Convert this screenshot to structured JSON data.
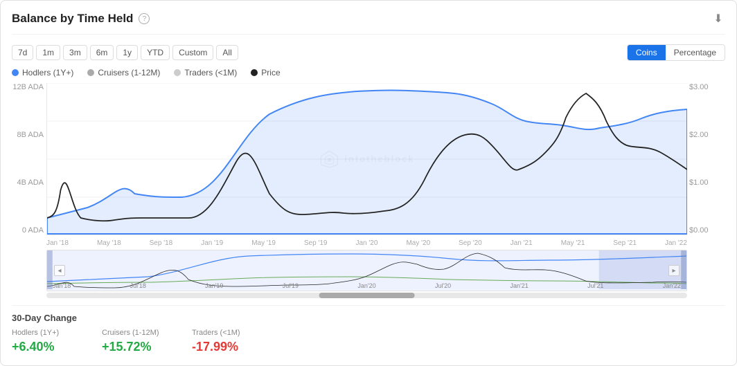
{
  "card": {
    "title": "Balance by Time Held",
    "help_label": "?",
    "download_icon": "⬇"
  },
  "time_filters": [
    {
      "label": "7d",
      "id": "7d"
    },
    {
      "label": "1m",
      "id": "1m"
    },
    {
      "label": "3m",
      "id": "3m"
    },
    {
      "label": "6m",
      "id": "6m"
    },
    {
      "label": "1y",
      "id": "1y"
    },
    {
      "label": "YTD",
      "id": "ytd"
    },
    {
      "label": "Custom",
      "id": "custom"
    },
    {
      "label": "All",
      "id": "all"
    }
  ],
  "view_toggle": {
    "coins_label": "Coins",
    "percentage_label": "Percentage",
    "active": "coins"
  },
  "legend": [
    {
      "label": "Hodlers (1Y+)",
      "color": "#4285f4",
      "type": "filled"
    },
    {
      "label": "Cruisers (1-12M)",
      "color": "#aaaaaa",
      "type": "filled"
    },
    {
      "label": "Traders (<1M)",
      "color": "#cccccc",
      "type": "filled"
    },
    {
      "label": "Price",
      "color": "#222222",
      "type": "filled"
    }
  ],
  "y_axis_left": [
    "12B ADA",
    "8B ADA",
    "4B ADA",
    "0 ADA"
  ],
  "y_axis_right": [
    "$3.00",
    "$2.00",
    "$1.00",
    "$0.00"
  ],
  "x_axis": [
    "Jan '18",
    "May '18",
    "Sep '18",
    "Jan '19",
    "May '19",
    "Sep '19",
    "Jan '20",
    "May '20",
    "Sep '20",
    "Jan '21",
    "May '21",
    "Sep '21",
    "Jan '22"
  ],
  "mini_x_axis": [
    "Jan'18",
    "Jul'18",
    "Jan'19",
    "Jul'19",
    "Jan'20",
    "Jul'20",
    "Jan'21",
    "Jul'21",
    "Jan'22"
  ],
  "stats": {
    "section_label": "30-Day Change",
    "items": [
      {
        "header": "Hodlers (1Y+)",
        "value": "+6.40%",
        "positive": true
      },
      {
        "header": "Cruisers (1-12M)",
        "value": "+15.72%",
        "positive": true
      },
      {
        "header": "Traders (<1M)",
        "value": "-17.99%",
        "positive": false
      }
    ]
  },
  "watermark": "intotheblock"
}
